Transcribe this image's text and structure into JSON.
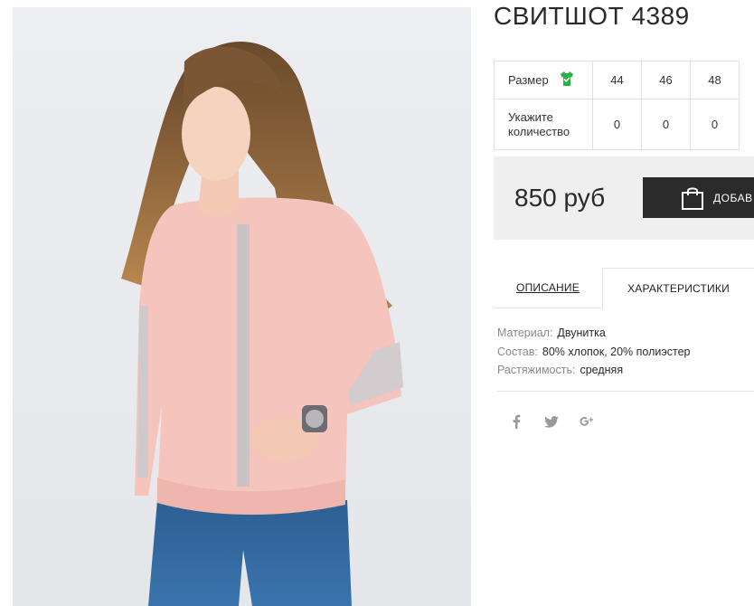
{
  "product": {
    "title": "СВИТШОТ 4389"
  },
  "sizes": {
    "row1_label": "Размер",
    "sizes": [
      "44",
      "46",
      "48"
    ],
    "row2_label_line1": "Укажите",
    "row2_label_line2": "количество",
    "quantities": [
      "0",
      "0",
      "0"
    ]
  },
  "price": {
    "value": "850 руб",
    "cart_label": "ДОБАВ"
  },
  "tabs": {
    "description": "ОПИСАНИЕ",
    "characteristics": "ХАРАКТЕРИСТИКИ"
  },
  "specs": [
    {
      "key": "Материал:",
      "value": "Двунитка"
    },
    {
      "key": "Состав:",
      "value": "80% хлопок, 20% полиэстер"
    },
    {
      "key": "Растяжимость:",
      "value": "средняя"
    }
  ],
  "social": [
    "facebook-icon",
    "twitter-icon",
    "google-plus-icon"
  ],
  "colors": {
    "accent_green": "#2bb14a",
    "button_dark": "#2b2b2b",
    "price_bg": "#efefef"
  }
}
